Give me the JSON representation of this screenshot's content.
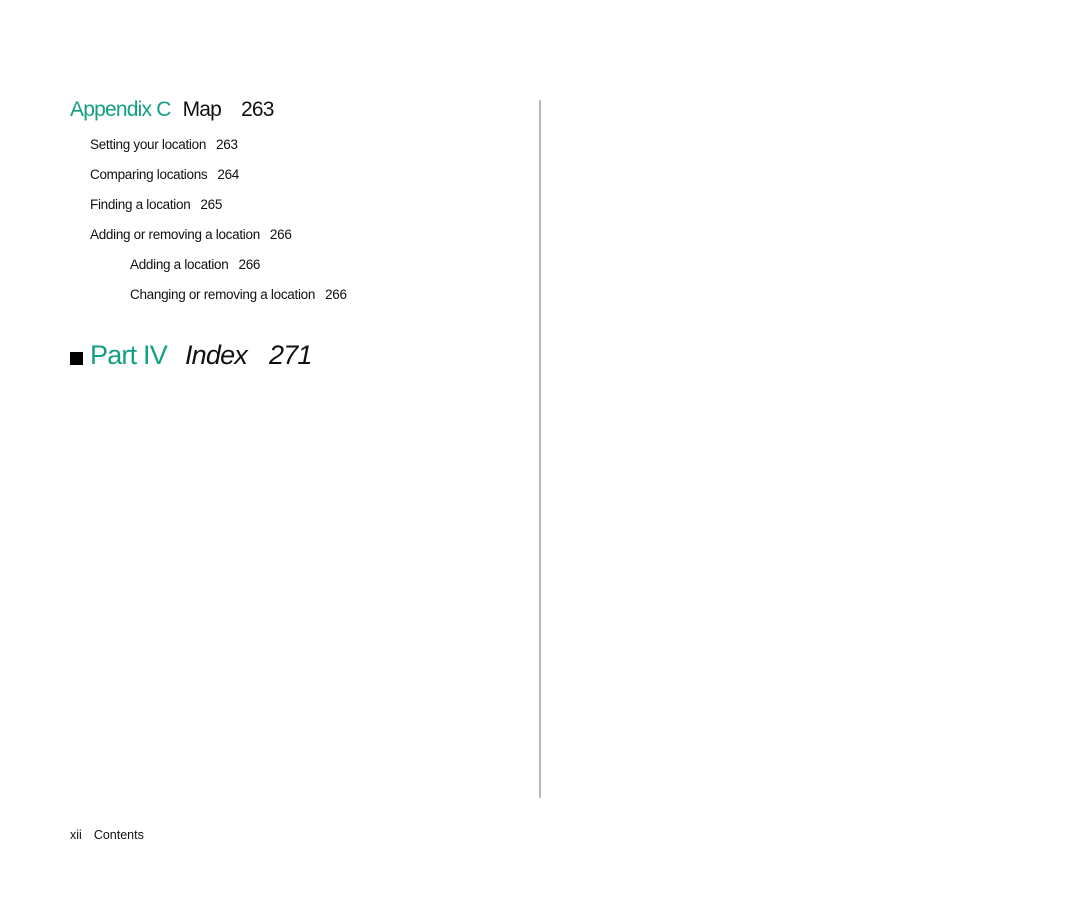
{
  "appendix": {
    "label": "Appendix C",
    "title": "Map",
    "page": "263",
    "entries": [
      {
        "title": "Setting your location",
        "page": "263",
        "level": 1
      },
      {
        "title": "Comparing locations",
        "page": "264",
        "level": 1
      },
      {
        "title": "Finding a location",
        "page": "265",
        "level": 1
      },
      {
        "title": "Adding or removing a location",
        "page": "266",
        "level": 1
      },
      {
        "title": "Adding a location",
        "page": "266",
        "level": 2
      },
      {
        "title": "Changing or removing a location",
        "page": "266",
        "level": 2
      }
    ]
  },
  "part": {
    "bullet_icon": "black-square",
    "label": "Part IV",
    "title": "Index",
    "page": "271"
  },
  "footer": {
    "page_number": "xii",
    "section": "Contents"
  },
  "colors": {
    "accent": "#13a082",
    "text": "#111111",
    "divider": "#b9b9b9"
  }
}
